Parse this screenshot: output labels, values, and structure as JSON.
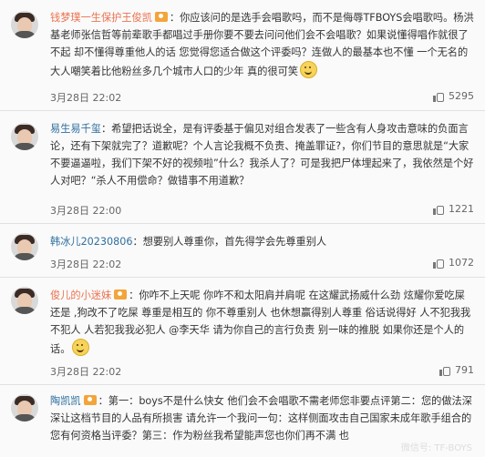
{
  "comments": [
    {
      "id": "c1",
      "username": "钱梦璞一生保护王俊凯",
      "text": "：你应该问的是选手会唱歌吗，而不是侮辱TFBOYS会唱歌吗。杨洪基老师张信哲等前辈歌手都唱过手册你要不要去问问他们会不会唱歌？如果说懂得唱作就很了不起 却不懂得尊重他人的话 您觉得您适合做这个评委吗？连做人的最基本也不懂 一个无名的大人嘲笑着比他粉丝多几个城市人口的少年 真的很可笑",
      "time": "3月28日 22:02",
      "likes": "5295",
      "has_vip": true,
      "has_emoji": true
    },
    {
      "id": "c2",
      "username": "易生易千玺",
      "text": "：希望把话说全，是有评委基于偏见对组合发表了一些含有人身攻击意味的负面言论，还有下架就完了？道歉呢？个人言论我概不负责、掩盖罪证?，你们节目的意思就是“大家不要逼逼啦，我们下架不好的视频啦”什么？我杀人了？可是我把尸体埋起来了，我依然是个好人对吧？“杀人不用偿命？做错事不用道歉？",
      "time": "3月28日 22:00",
      "likes": "1221",
      "has_vip": false,
      "has_emoji": false
    },
    {
      "id": "c3",
      "username": "韩冰儿20230806",
      "text": "：想要别人尊重你，首先得学会先尊重别人",
      "time": "3月28日 22:02",
      "likes": "1072",
      "has_vip": false,
      "has_emoji": false
    },
    {
      "id": "c4",
      "username": "俊儿的小迷妹",
      "text": "：你咋不上天呢 你咋不和太阳肩并肩呢 在这耀武扬威什么劲 炫耀你爱吃屎还是 ,狗改不了吃屎 尊重是相互的 你不尊重别人 也休想赢得别人尊重 俗话说得好 人不犯我我不犯人 人若犯我我必犯人 @李天华 请为你自己的言行负责 别一味的推脱 如果你还是个人的话。",
      "mention": "@李天华",
      "time": "3月28日 22:02",
      "likes": "791",
      "has_vip": true,
      "has_emoji": true
    },
    {
      "id": "c5",
      "username": "陶凯凯",
      "text": "：第一：boys不是什么快女 他们会不会唱歌不需老师您非要点评第二：您的做法深深让这档节目的人品有所损害 请允许一个我问一句：这样侧面攻击自己国家未成年歌手组合的您有何资格当评委？第三：作为粉丝我希望能声您也你们再不满 也",
      "time": "",
      "likes": "",
      "has_vip": true,
      "has_emoji": false
    }
  ],
  "watermark": "微信号: TF-BOYS"
}
